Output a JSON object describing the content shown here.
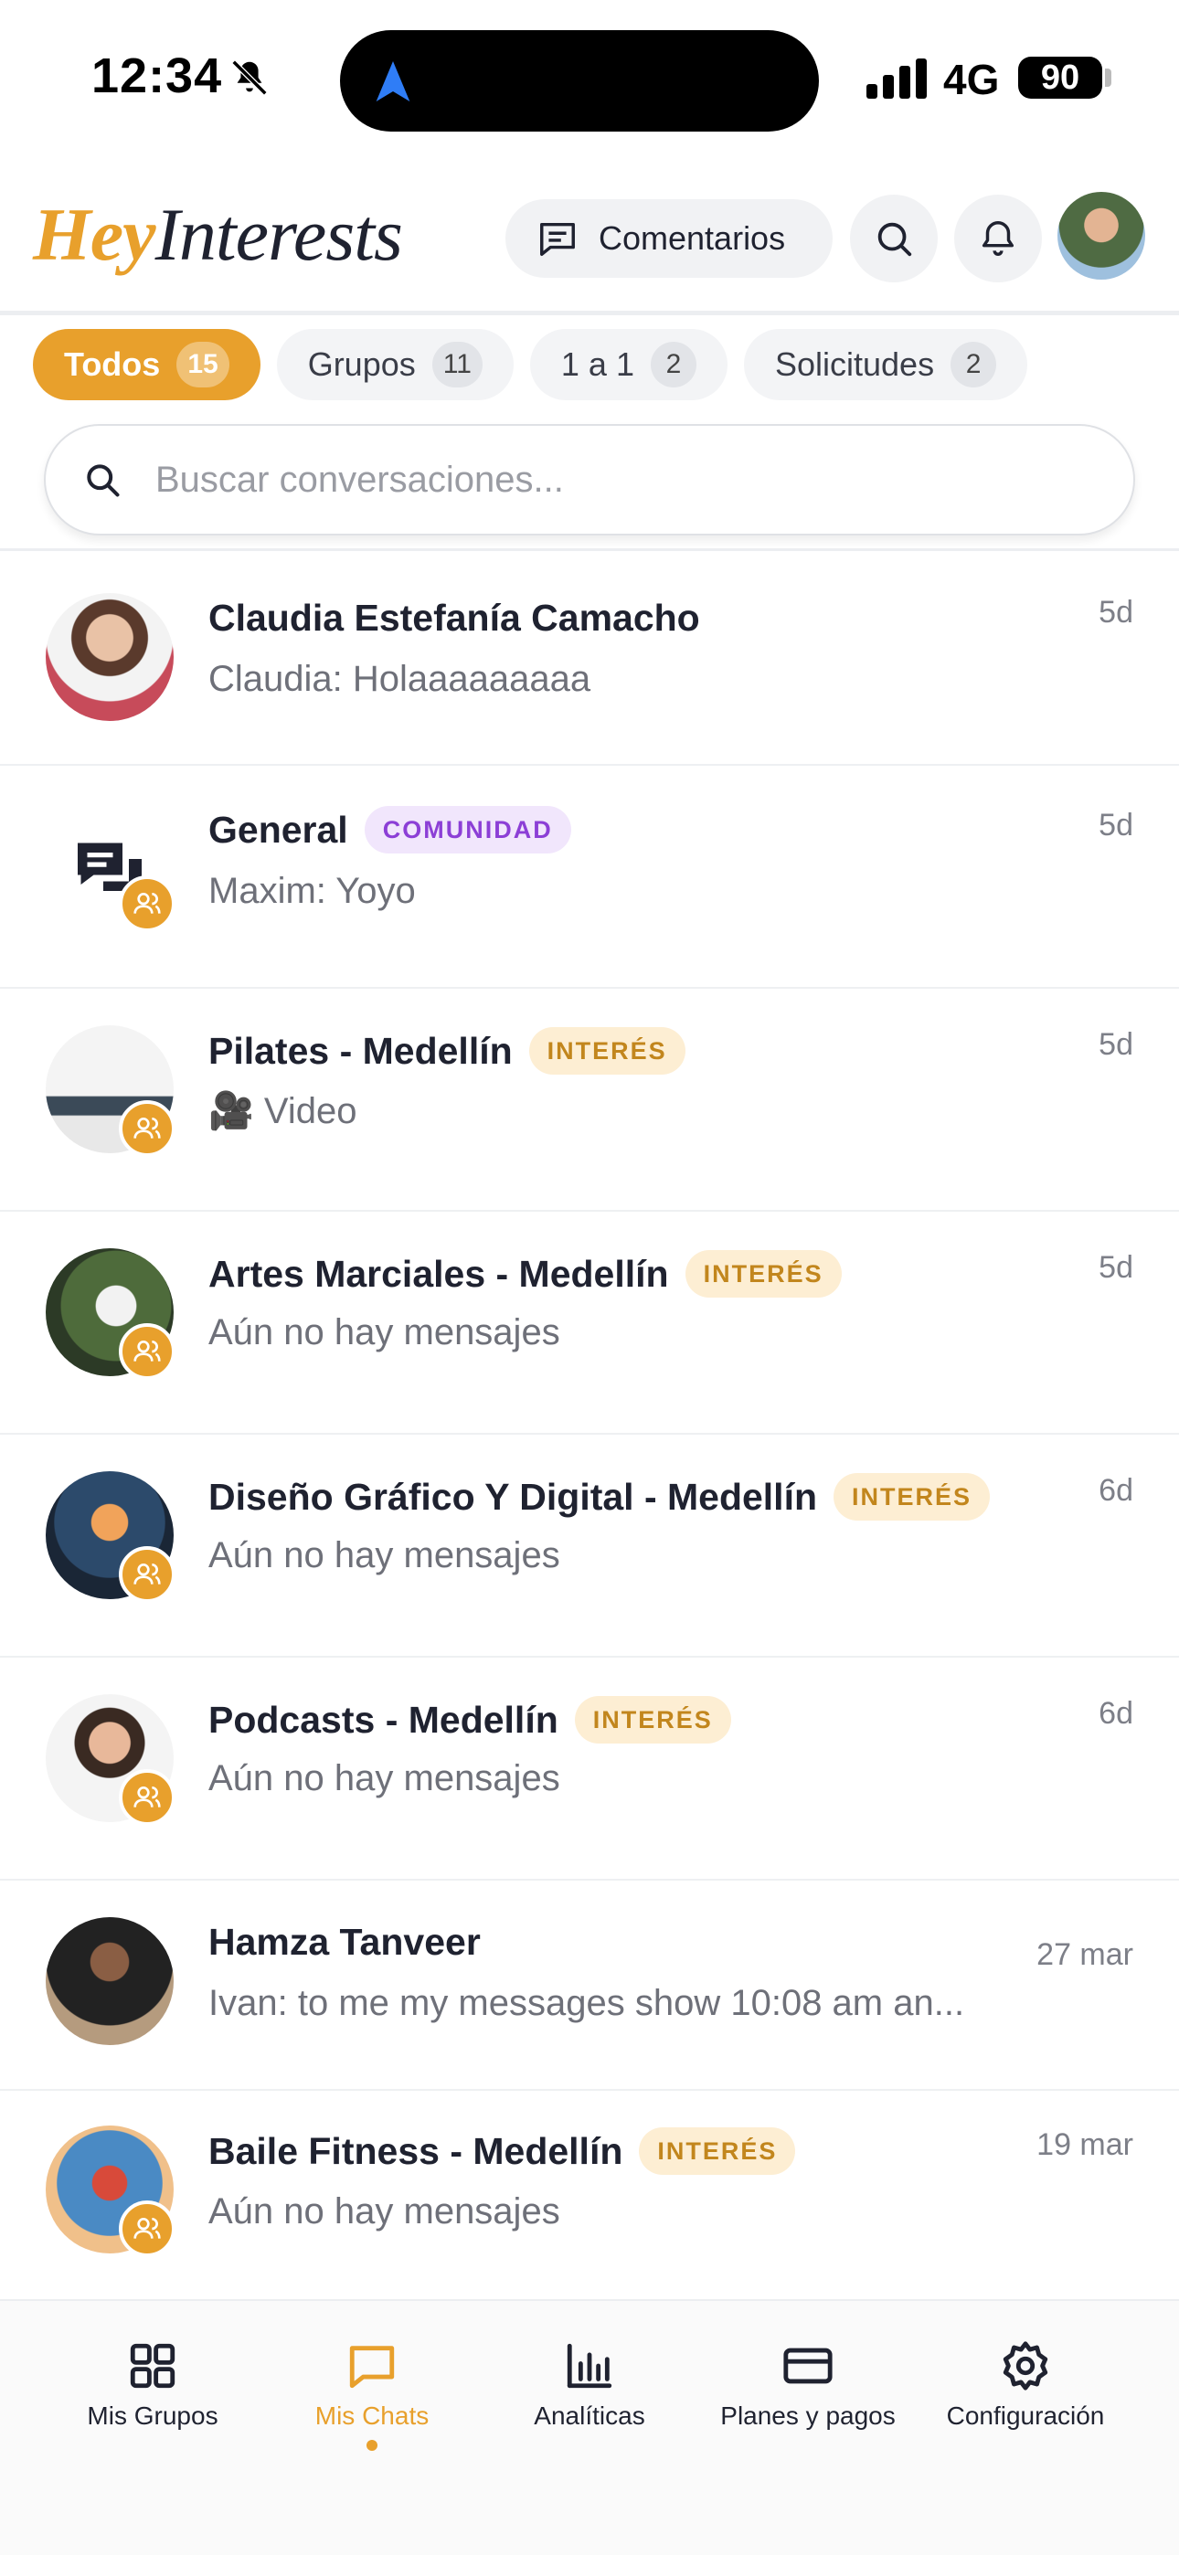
{
  "status_bar": {
    "time": "12:34",
    "network": "4G",
    "battery": "90"
  },
  "header": {
    "logo_hey": "Hey",
    "logo_interests": "Interests",
    "comments_label": "Comentarios"
  },
  "tabs": [
    {
      "label": "Todos",
      "count": "15",
      "active": true
    },
    {
      "label": "Grupos",
      "count": "11",
      "active": false
    },
    {
      "label": "1 a 1",
      "count": "2",
      "active": false
    },
    {
      "label": "Solicitudes",
      "count": "2",
      "active": false
    }
  ],
  "search": {
    "placeholder": "Buscar conversaciones...",
    "value": ""
  },
  "conversations": [
    {
      "name": "Claudia Estefanía Camacho",
      "tag": "",
      "sender": "Claudia:",
      "message": "Holaaaaaaaaa",
      "date": "5d",
      "group": false,
      "avatar": "person-photo"
    },
    {
      "name": "General",
      "tag": "COMUNIDAD",
      "sender": "Maxim:",
      "message": "Yoyo",
      "date": "5d",
      "group": true,
      "avatar": "chat-bubbles-icon"
    },
    {
      "name": "Pilates - Medellín",
      "tag": "INTERÉS",
      "sender": "",
      "message": "🎥 Video",
      "date": "5d",
      "group": true,
      "avatar": "pilates-photo"
    },
    {
      "name": "Artes Marciales - Medellín",
      "tag": "INTERÉS",
      "sender": "",
      "message": "Aún no hay mensajes",
      "date": "5d",
      "group": true,
      "avatar": "martial-arts-photo"
    },
    {
      "name": "Diseño Gráfico Y Digital - Medellín",
      "tag": "INTERÉS",
      "sender": "",
      "message": "Aún no hay mensajes",
      "date": "6d",
      "group": true,
      "avatar": "design-photo"
    },
    {
      "name": "Podcasts - Medellín",
      "tag": "INTERÉS",
      "sender": "",
      "message": "Aún no hay mensajes",
      "date": "6d",
      "group": true,
      "avatar": "podcast-photo"
    },
    {
      "name": "Hamza Tanveer",
      "tag": "",
      "sender": "Ivan:",
      "message": "to me my messages show 10:08 am an...",
      "date": "27 mar",
      "group": false,
      "avatar": "person-photo"
    },
    {
      "name": "Baile Fitness - Medellín",
      "tag": "INTERÉS",
      "sender": "",
      "message": "Aún no hay mensajes",
      "date": "19 mar",
      "group": true,
      "avatar": "dance-photo"
    }
  ],
  "bottom_nav": [
    {
      "label": "Mis Grupos",
      "icon": "grid-icon",
      "active": false
    },
    {
      "label": "Mis Chats",
      "icon": "chat-icon",
      "active": true
    },
    {
      "label": "Analíticas",
      "icon": "bar-chart-icon",
      "active": false
    },
    {
      "label": "Planes y pagos",
      "icon": "credit-card-icon",
      "active": false
    },
    {
      "label": "Configuración",
      "icon": "gear-icon",
      "active": false
    }
  ],
  "colors": {
    "accent": "#e8a02c",
    "interest_tag_bg": "#fdeed3",
    "community_tag_bg": "#f1e6fc",
    "community_tag_text": "#8c3fd6"
  }
}
